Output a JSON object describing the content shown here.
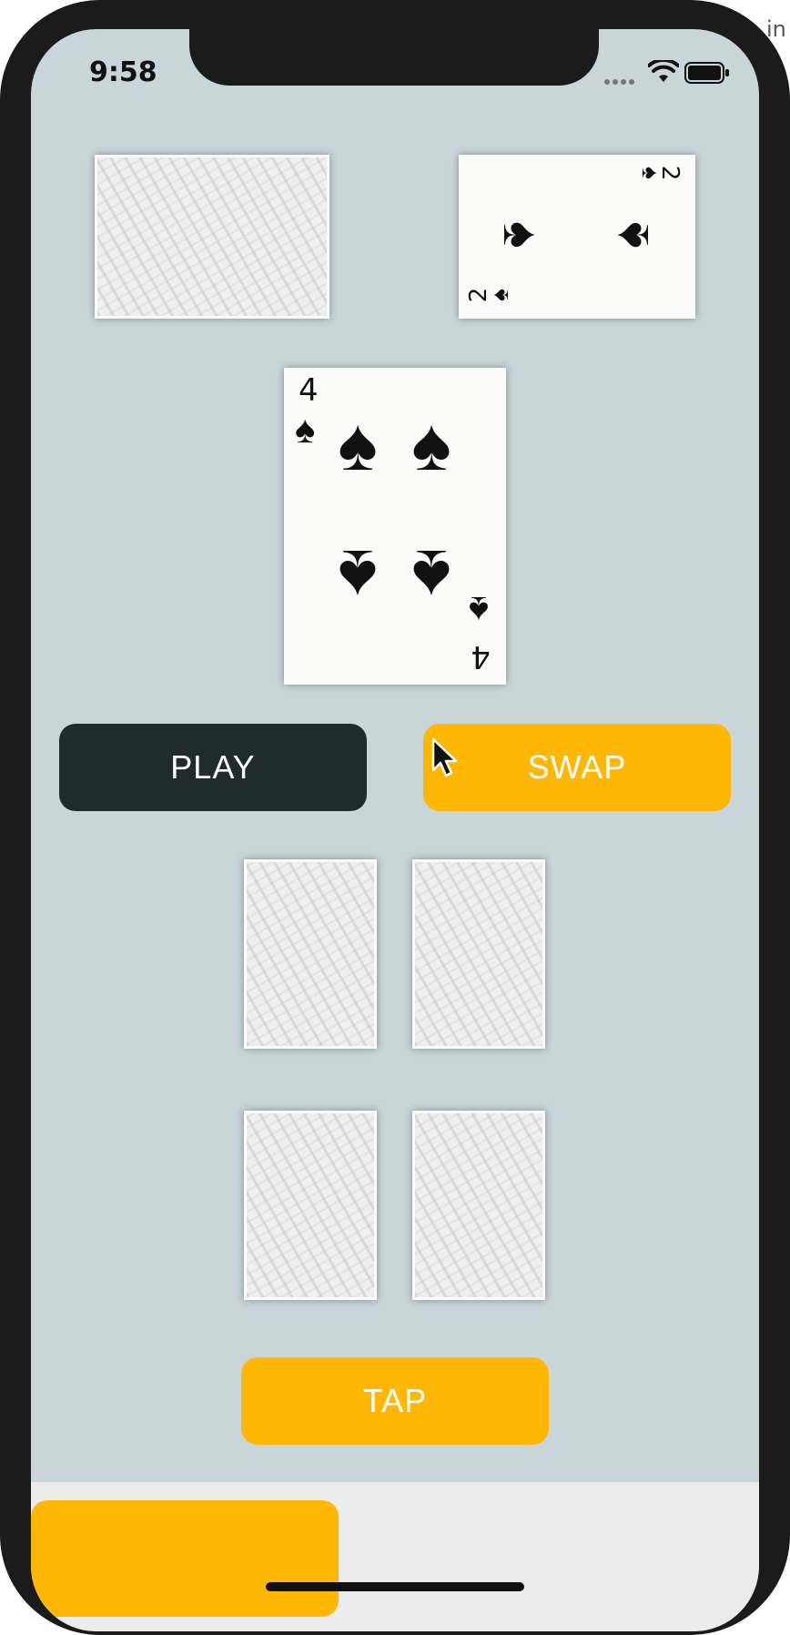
{
  "status_bar": {
    "time": "9:58",
    "signal_icon": "signal-dots-icon",
    "wifi_icon": "wifi-icon",
    "battery_icon": "battery-icon"
  },
  "corner_text": "in",
  "deck_card": {
    "state": "face-down"
  },
  "discard_card": {
    "rank": "2",
    "suit": "spades",
    "suit_symbol": "♠",
    "state": "face-up"
  },
  "drawn_card": {
    "rank": "4",
    "suit": "spades",
    "suit_symbol": "♠",
    "state": "face-up"
  },
  "actions": {
    "play_label": "PLAY",
    "swap_label": "SWAP",
    "tap_label": "TAP"
  },
  "hand": [
    {
      "state": "face-down"
    },
    {
      "state": "face-down"
    },
    {
      "state": "face-down"
    },
    {
      "state": "face-down"
    }
  ],
  "colors": {
    "table": "#c9d5d9",
    "play_button": "#1f2b2e",
    "accent_button": "#ffb703",
    "button_text": "#ffffff"
  },
  "bottom_bar": {
    "button_label": ""
  }
}
